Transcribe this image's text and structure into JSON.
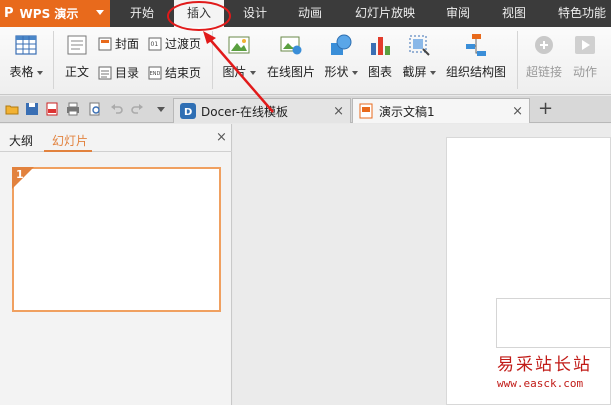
{
  "app": {
    "name": "WPS 演示",
    "logo": "P"
  },
  "menu": {
    "items": [
      "开始",
      "插入",
      "设计",
      "动画",
      "幻灯片放映",
      "审阅",
      "视图",
      "特色功能"
    ],
    "active_index": 1
  },
  "ribbon": {
    "table_label": "表格",
    "body_label": "正文",
    "cover_label": "封面",
    "toc_label": "目录",
    "transition_label": "过渡页",
    "ending_label": "结束页",
    "picture_label": "图片",
    "online_picture_label": "在线图片",
    "shape_label": "形状",
    "chart_label": "图表",
    "screenshot_label": "截屏",
    "org_chart_label": "组织结构图",
    "hyperlink_label": "超链接",
    "action_label": "动作"
  },
  "tabs": {
    "items": [
      {
        "label": "Docer-在线模板",
        "active": false
      },
      {
        "label": "演示文稿1",
        "active": true
      }
    ],
    "close_glyph": "×",
    "new_tab_glyph": "+"
  },
  "panel": {
    "tabs": [
      "大纲",
      "幻灯片"
    ],
    "active_index": 1,
    "close_glyph": "×",
    "slides": [
      {
        "number": "1"
      }
    ]
  },
  "watermark": {
    "title": "易采站长站",
    "url": "www.easck.com"
  },
  "colors": {
    "accent": "#e86a1c",
    "menubar": "#3b3b3b",
    "panel_tab_active": "#e2823e",
    "annotation": "#e11a1a",
    "watermark": "#c11b17"
  },
  "icons": [
    "table-icon",
    "body-icon",
    "cover-icon",
    "toc-icon",
    "transition-icon",
    "ending-icon",
    "picture-icon",
    "online-picture-icon",
    "shape-icon",
    "chart-icon",
    "screenshot-icon",
    "org-chart-icon",
    "hyperlink-icon",
    "action-icon",
    "open-icon",
    "save-icon",
    "export-pdf-icon",
    "print-icon",
    "print-preview-icon",
    "undo-icon",
    "redo-icon",
    "dropdown-icon",
    "docer-icon",
    "presentation-doc-icon",
    "close-icon",
    "plus-icon"
  ]
}
